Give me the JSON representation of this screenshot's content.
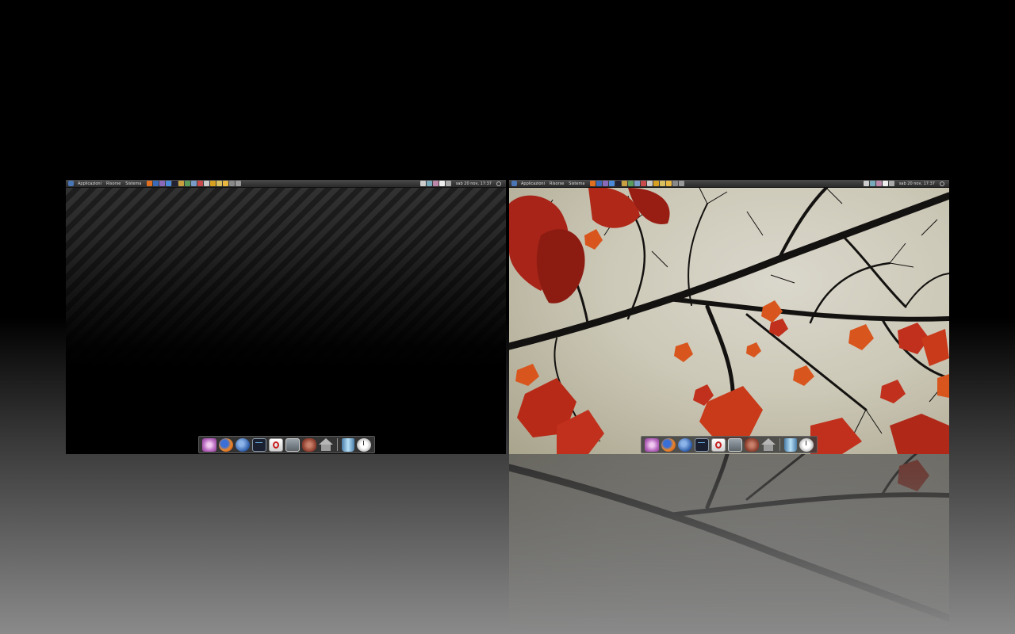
{
  "workspaces": [
    {
      "id": "workspace-1",
      "wallpaper": "dark-diagonal-stripes",
      "panel": {
        "menus": [
          "Applicazioni",
          "Risorse",
          "Sistema"
        ],
        "clock": "sab 20 nov, 17:37"
      },
      "dock": [
        "settings-icon",
        "firefox-icon",
        "thunderbird-icon",
        "terminal-icon",
        "opera-icon",
        "window-icon",
        "gimp-icon",
        "home-icon",
        "trash-icon",
        "clock-icon"
      ]
    },
    {
      "id": "workspace-2",
      "wallpaper": "autumn-maple-branches",
      "panel": {
        "menus": [
          "Applicazioni",
          "Risorse",
          "Sistema"
        ],
        "clock": "sab 20 nov, 17:37"
      },
      "dock": [
        "settings-icon",
        "firefox-icon",
        "thunderbird-icon",
        "terminal-icon",
        "opera-icon",
        "window-icon",
        "gimp-icon",
        "home-icon",
        "trash-icon",
        "clock-icon"
      ]
    }
  ],
  "colors": {
    "leaf_red": "#c0301c",
    "leaf_orange": "#d8561e",
    "branch": "#141210",
    "sky": "#d4d1c4",
    "panel": "#3a3a3a"
  }
}
